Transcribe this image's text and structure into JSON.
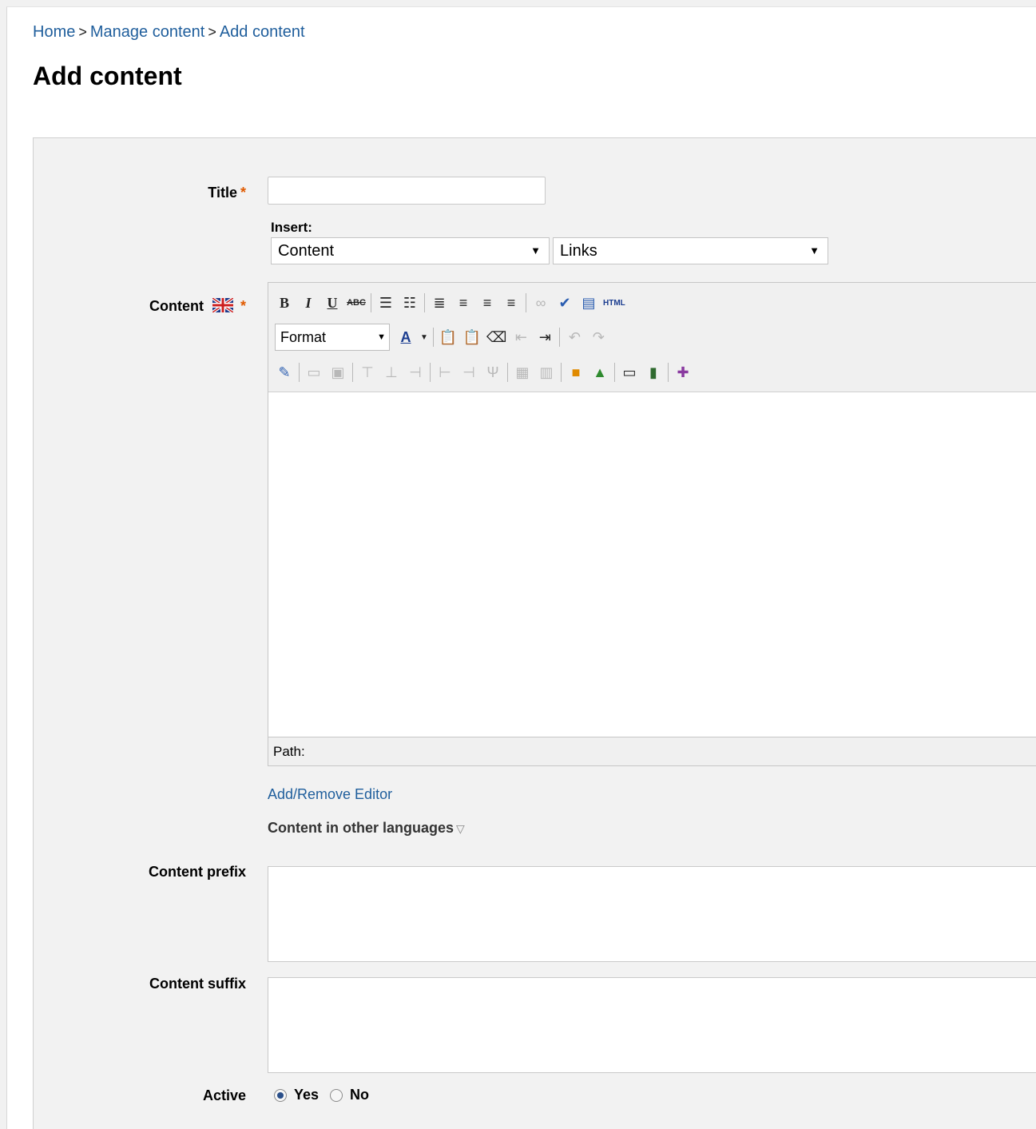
{
  "breadcrumb": {
    "home": "Home",
    "manage": "Manage content",
    "current": "Add content",
    "separator": ">"
  },
  "page_title": "Add content",
  "form": {
    "title_label": "Title",
    "required_marker": "*",
    "title_value": "",
    "insert_label": "Insert:",
    "insert_content_select": "Content",
    "insert_links_select": "Links",
    "content_label": "Content",
    "content_language_flag": "uk-flag-icon",
    "editor": {
      "format_select": "Format",
      "html_button": "HTML",
      "path_label": "Path:",
      "toolbar_icons": {
        "row1": [
          "bold-icon",
          "italic-icon",
          "underline-icon",
          "strikethrough-icon",
          "bullet-list-icon",
          "numbered-list-icon",
          "align-justify-icon",
          "align-left-icon",
          "align-center-icon",
          "align-right-icon",
          "link-icon",
          "spellcheck-icon",
          "preview-icon",
          "html-icon"
        ],
        "row2": [
          "format-select",
          "text-color-icon",
          "paste-text-icon",
          "paste-word-icon",
          "eraser-icon",
          "outdent-icon",
          "indent-icon",
          "undo-icon",
          "redo-icon"
        ],
        "row3": [
          "edit-icon",
          "cell-props-icon",
          "row-props-icon",
          "insert-row-before-icon",
          "insert-row-after-icon",
          "delete-row-icon",
          "insert-col-before-icon",
          "insert-col-after-icon",
          "delete-col-icon",
          "table-icon",
          "merge-cells-icon",
          "image-icon",
          "picture-icon",
          "media-icon",
          "film-icon",
          "plugin-icon"
        ]
      }
    },
    "add_remove_editor": "Add/Remove Editor",
    "other_languages": "Content in other languages",
    "prefix_label": "Content prefix",
    "suffix_label": "Content suffix",
    "active_label": "Active",
    "active_yes": "Yes",
    "active_no": "No",
    "active_value": "Yes"
  },
  "colors": {
    "link": "#1f5e9c",
    "required": "#e05a00",
    "panel_bg": "#f2f2f2"
  }
}
